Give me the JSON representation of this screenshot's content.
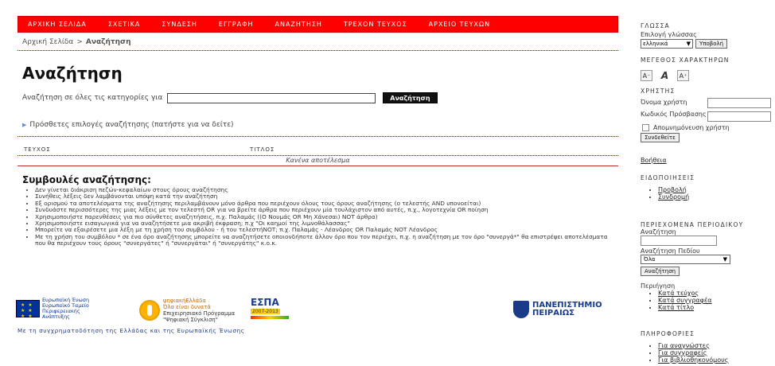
{
  "nav": {
    "items": [
      "ΑΡΧΙΚΗ ΣΕΛΙΔΑ",
      "ΣΧΕΤΙΚΑ",
      "ΣΥΝΔΕΣΗ",
      "ΕΓΓΡΑΦΗ",
      "ΑΝΑΖΗΤΗΣΗ",
      "ΤΡΕΧΟΝ ΤΕΥΧΟΣ",
      "ΑΡΧΕΙΟ ΤΕΥΧΩΝ"
    ],
    "bg_color": "#ff0000"
  },
  "breadcrumb": {
    "home": "Αρχική Σελίδα",
    "separator": ">",
    "current": "Αναζήτηση"
  },
  "page_title": "Αναζήτηση",
  "search": {
    "label": "Αναζήτηση σε όλες τις κατηγορίες για",
    "value": "",
    "button": "Αναζήτηση"
  },
  "more_options": "Πρόσθετες επιλογές αναζήτησης (πατήστε για να δείτε)",
  "results": {
    "col_issue": "ΤΕΥΧΟΣ",
    "col_title": "ΤΙΤΛΟΣ",
    "empty": "Κανένα αποτέλεσμα"
  },
  "tips": {
    "title": "Συμβουλές αναζήτησης:",
    "items": [
      "Δεν γίνεται διάκριση πεζών-κεφαλαίων στους όρους αναζήτησης",
      "Συνήθεις λέξεις δεν λαμβάνονται υπόψη κατά την αναζήτηση",
      "Εξ ορισμού τα αποτελέσματα της αναζήτησης περιλαμβάνουν μόνο άρθρα που περιέχουν όλους τους όρους αναζήτησης (ο τελεστής AND υπονοείται)",
      "Συνδυάστε περισσότερες της μιας λέξεις με τον τελεστή OR για να βρείτε άρθρα που περιέχουν μία τουλάχιστον από αυτές, π.χ., λογοτεχνία OR ποίηση",
      "Χρησιμοποιήστε παρενθέσεις για πιο σύνθετες αναζητήσεις, π.χ. Παλαμάς ((Ο Νουμάς OR Μη Χάνεσαι) NOT άρθρα)",
      "Χρησιμοποιήστε εισαγωγικά για να αναζητήσετε μια ακριβή έκφραση; π.χ \"Οι καημοί της λιμνοθάλασσας\"",
      "Μπορείτε να εξαιρέσετε μια λέξη με τη χρήση του συμβόλου - ή του τελεστήNOT; π.χ. Παλαμάς - Λέανδρος OR Παλαμάς NOT Λέανδρος",
      "Με τη χρήση του συμβόλου * σε ένα όρο αναζήτησης μπορείτε να αναζητήσετε οποιονδήποτε άλλον όρο που τον περιέχει, π.χ. η αναζήτηση με τον όρο \"συνεργά*\" θα επιστρέψει αποτελέσματα που θα περιέχουν τους όρους \"συνεργάτες\" ή \"συνεργάται\" ή \"συνεργάτης\" κ.ο.κ."
    ]
  },
  "logos": {
    "eu_lines": [
      "Ευρωπαϊκή Ένωση",
      "Ευρωπαϊκό Ταμείο",
      "Περιφερειακής",
      "Ανάπτυξης"
    ],
    "psif_lines": [
      "ψηφιακήΕλλάδα",
      "Όλα είναι δυνατά",
      "Επιχειρησιακό Πρόγραμμα",
      "\"Ψηφιακή Σύγκλιση\""
    ],
    "espa_title": "ΕΣΠΑ",
    "espa_years": "2007-2013",
    "unipi_lines": [
      "ΠΑΝΕΠΙΣΤΗΜΙΟ",
      "ΠΕΙΡΑΙΩΣ"
    ],
    "funding": "Με τη συγχρηματοδότηση της Ελλάδας και της Ευρωπαϊκής Ένωσης"
  },
  "sidebar": {
    "language_title": "ΓΛΩΣΣΑ",
    "language_label": "Επιλογή γλώσσας",
    "language_value": "ελληνικά",
    "language_submit": "Υποβολή",
    "fontsize_title": "ΜΕΓΕΘΟΣ ΧΑΡΑΚΤΗΡΩΝ",
    "font_icons": [
      "A⁻",
      "A",
      "A⁺"
    ],
    "user_title": "ΧΡΗΣΤΗΣ",
    "username_label": "Όνομα χρήστη",
    "password_label": "Κωδικός Πρόσβασης",
    "remember_label": "Απομνημόνευση χρήστη",
    "login_button": "Συνδεθείτε",
    "help_link": "Βοήθεια",
    "notifications_title": "ΕΙΔΟΠΟΙΗΣΕΙΣ",
    "notifications": [
      "Προβολή",
      "Συνδρομή"
    ],
    "journal_title": "ΠΕΡΙΕΧΟΜΕΝΑ ΠΕΡΙΟΔΙΚΟΥ",
    "journal_search_label": "Αναζήτηση",
    "field_label": "Αναζήτηση Πεδίου",
    "field_value": "Όλα",
    "journal_search_button": "Αναζήτηση",
    "browse_label": "Περιήγηση",
    "browse": [
      "Κατά τεύχος",
      "Κατά συγγραφέα",
      "Κατά τίτλο"
    ],
    "info_title": "ΠΛΗΡΟΦΟΡΙΕΣ",
    "info": [
      "Για αναγνώστες",
      "Για συγγραφείς",
      "Για βιβλιοθηκονόμους"
    ]
  }
}
